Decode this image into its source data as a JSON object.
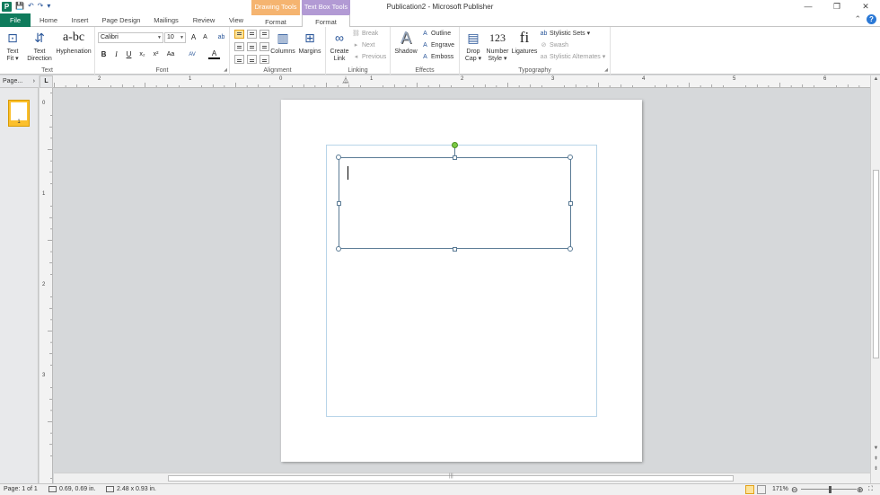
{
  "window": {
    "title": "Publication2 - Microsoft Publisher",
    "context_drawing": "Drawing Tools",
    "context_textbox": "Text Box Tools",
    "minimize_icon": "—",
    "restore_icon": "❐",
    "close_icon": "✕"
  },
  "qat": {
    "app_icon": "P",
    "save_icon": "💾",
    "undo_icon": "↶",
    "redo_icon": "↷",
    "customize_icon": "▾"
  },
  "tabs": {
    "file": "File",
    "home": "Home",
    "insert": "Insert",
    "page_design": "Page Design",
    "mailings": "Mailings",
    "review": "Review",
    "view": "View",
    "format_drawing": "Format",
    "format_textbox": "Format"
  },
  "tab_right": {
    "collapse_icon": "⌃",
    "help_icon": "?"
  },
  "ribbon": {
    "text_group": {
      "label": "Text",
      "text_fit": "Text\nFit ▾",
      "text_direction": "Text\nDirection",
      "hyphenation": "Hyphenation"
    },
    "font_group": {
      "label": "Font",
      "font_name": "Calibri",
      "font_size": "10",
      "grow": "A",
      "shrink": "A",
      "bold": "B",
      "italic": "I",
      "underline": "U",
      "subscript": "x₂",
      "superscript": "x²",
      "change_case": "Aa",
      "char_spacing": "AV",
      "font_color": "A",
      "clear_format": "ab"
    },
    "alignment_group": {
      "label": "Alignment",
      "columns": "Columns",
      "margins": "Margins"
    },
    "linking_group": {
      "label": "Linking",
      "create_link": "Create\nLink",
      "break": "Break",
      "next": "Next",
      "previous": "Previous"
    },
    "effects_group": {
      "label": "Effects",
      "shadow": "Shadow",
      "outline": "Outline",
      "engrave": "Engrave",
      "emboss": "Emboss"
    },
    "typography_group": {
      "label": "Typography",
      "drop_cap": "Drop\nCap ▾",
      "number_style": "Number\nStyle ▾",
      "ligatures": "Ligatures",
      "number_glyph": "123",
      "ligature_glyph": "fi",
      "stylistic_sets": "Stylistic Sets ▾",
      "swash": "Swash",
      "stylistic_alternates": "Stylistic Alternates ▾"
    }
  },
  "pages_panel": {
    "header": "Page...",
    "page_number": "1"
  },
  "ruler": {
    "corner": "L",
    "h_labels": [
      "2",
      "1",
      "0",
      "1",
      "2",
      "3",
      "4",
      "5",
      "6"
    ],
    "v_labels": [
      "0",
      "1",
      "2",
      "3"
    ]
  },
  "status": {
    "page": "Page: 1 of 1",
    "position": "0.69, 0.69 in.",
    "size": "2.48 x 0.93 in.",
    "zoom": "171%",
    "zoom_out": "⊖",
    "zoom_in": "⊕",
    "fit_icon": "⛶"
  }
}
